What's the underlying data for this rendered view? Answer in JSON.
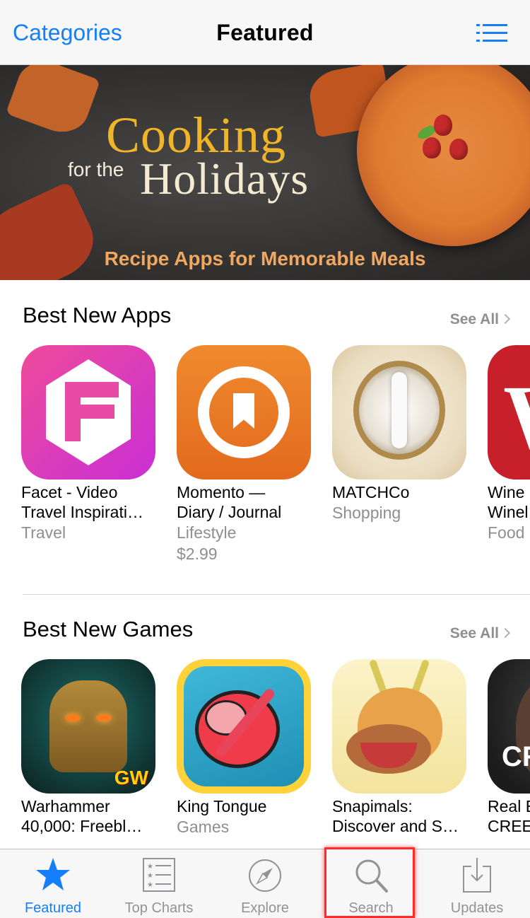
{
  "navbar": {
    "left_label": "Categories",
    "title": "Featured",
    "right_icon": "list-icon"
  },
  "banner": {
    "title_line1": "Cooking",
    "title_prefix": "for the",
    "title_line2": "Holidays",
    "subtitle": "Recipe Apps for Memorable Meals"
  },
  "best_new_apps": {
    "title": "Best New Apps",
    "see_all": "See All",
    "items": [
      {
        "name_line1": "Facet - Video",
        "name_line2": "Travel Inspirati…",
        "category": "Travel",
        "price": "",
        "icon": "facet-app-icon"
      },
      {
        "name_line1": "Momento —",
        "name_line2": "Diary / Journal",
        "category": "Lifestyle",
        "price": "$2.99",
        "icon": "momento-app-icon"
      },
      {
        "name_line1": "MATCHCo",
        "name_line2": "",
        "category": "Shopping",
        "price": "",
        "icon": "matchco-app-icon"
      },
      {
        "name_line1": "Wine",
        "name_line2": "Winel",
        "category": "Food",
        "price": "",
        "icon": "wine-app-icon"
      }
    ]
  },
  "best_new_games": {
    "title": "Best New Games",
    "see_all": "See All",
    "items": [
      {
        "name_line1": "Warhammer",
        "name_line2": "40,000: Freebl…",
        "category": "",
        "icon": "warhammer-app-icon"
      },
      {
        "name_line1": "King Tongue",
        "name_line2": "",
        "category": "Games",
        "icon": "king-tongue-app-icon"
      },
      {
        "name_line1": "Snapimals:",
        "name_line2": "Discover and S…",
        "category": "",
        "icon": "snapimals-app-icon"
      },
      {
        "name_line1": "Real E",
        "name_line2": "CREE",
        "category": "",
        "icon": "real-boxing-app-icon"
      }
    ]
  },
  "tabbar": {
    "tabs": [
      {
        "label": "Featured",
        "icon": "star-icon",
        "active": true
      },
      {
        "label": "Top Charts",
        "icon": "top-charts-icon",
        "active": false
      },
      {
        "label": "Explore",
        "icon": "compass-icon",
        "active": false
      },
      {
        "label": "Search",
        "icon": "search-icon",
        "active": false
      },
      {
        "label": "Updates",
        "icon": "download-tray-icon",
        "active": false
      }
    ]
  },
  "colors": {
    "accent": "#147efb",
    "inactive": "#929297",
    "highlight": "#ff2a2a"
  }
}
